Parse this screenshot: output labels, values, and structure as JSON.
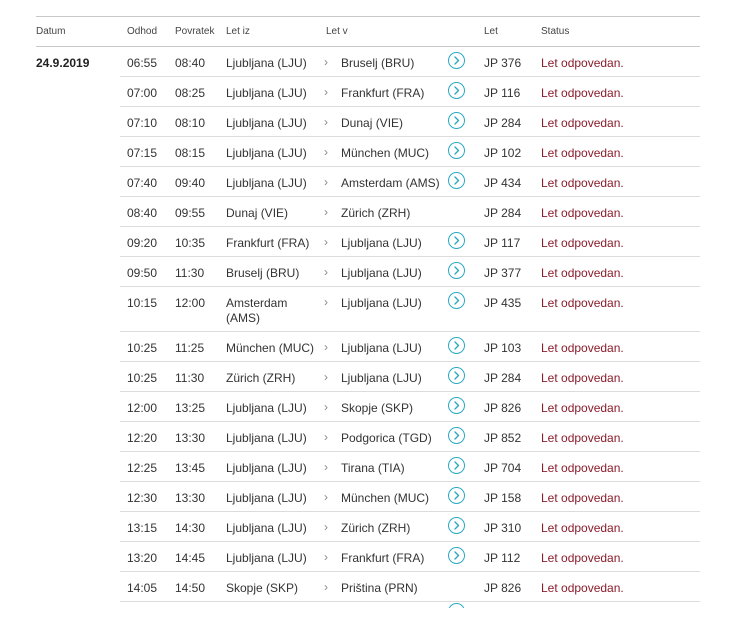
{
  "columns": {
    "date": "Datum",
    "dep": "Odhod",
    "ret": "Povratek",
    "from": "Let iz",
    "to": "Let v",
    "flight": "Let",
    "status": "Status"
  },
  "date_value": "24.9.2019",
  "rows": [
    {
      "dep": "06:55",
      "ret": "08:40",
      "from": "Ljubljana (LJU)",
      "to": "Bruselj (BRU)",
      "flight": "JP 376",
      "status": "Let odpovedan.",
      "arrow": true
    },
    {
      "dep": "07:00",
      "ret": "08:25",
      "from": "Ljubljana (LJU)",
      "to": "Frankfurt (FRA)",
      "flight": "JP 116",
      "status": "Let odpovedan.",
      "arrow": true
    },
    {
      "dep": "07:10",
      "ret": "08:10",
      "from": "Ljubljana (LJU)",
      "to": "Dunaj (VIE)",
      "flight": "JP 284",
      "status": "Let odpovedan.",
      "arrow": true
    },
    {
      "dep": "07:15",
      "ret": "08:15",
      "from": "Ljubljana (LJU)",
      "to": "München (MUC)",
      "flight": "JP 102",
      "status": "Let odpovedan.",
      "arrow": true
    },
    {
      "dep": "07:40",
      "ret": "09:40",
      "from": "Ljubljana (LJU)",
      "to": "Amsterdam (AMS)",
      "flight": "JP 434",
      "status": "Let odpovedan.",
      "arrow": true
    },
    {
      "dep": "08:40",
      "ret": "09:55",
      "from": "Dunaj (VIE)",
      "to": "Zürich (ZRH)",
      "flight": "JP 284",
      "status": "Let odpovedan.",
      "arrow": false
    },
    {
      "dep": "09:20",
      "ret": "10:35",
      "from": "Frankfurt (FRA)",
      "to": "Ljubljana (LJU)",
      "flight": "JP 117",
      "status": "Let odpovedan.",
      "arrow": true
    },
    {
      "dep": "09:50",
      "ret": "11:30",
      "from": "Bruselj (BRU)",
      "to": "Ljubljana (LJU)",
      "flight": "JP 377",
      "status": "Let odpovedan.",
      "arrow": true
    },
    {
      "dep": "10:15",
      "ret": "12:00",
      "from": "Amsterdam (AMS)",
      "to": "Ljubljana (LJU)",
      "flight": "JP 435",
      "status": "Let odpovedan.",
      "arrow": true,
      "tall": true
    },
    {
      "dep": "10:25",
      "ret": "11:25",
      "from": "München (MUC)",
      "to": "Ljubljana (LJU)",
      "flight": "JP 103",
      "status": "Let odpovedan.",
      "arrow": true
    },
    {
      "dep": "10:25",
      "ret": "11:30",
      "from": "Zürich (ZRH)",
      "to": "Ljubljana (LJU)",
      "flight": "JP 284",
      "status": "Let odpovedan.",
      "arrow": true
    },
    {
      "dep": "12:00",
      "ret": "13:25",
      "from": "Ljubljana (LJU)",
      "to": "Skopje (SKP)",
      "flight": "JP 826",
      "status": "Let odpovedan.",
      "arrow": true
    },
    {
      "dep": "12:20",
      "ret": "13:30",
      "from": "Ljubljana (LJU)",
      "to": "Podgorica (TGD)",
      "flight": "JP 852",
      "status": "Let odpovedan.",
      "arrow": true
    },
    {
      "dep": "12:25",
      "ret": "13:45",
      "from": "Ljubljana (LJU)",
      "to": "Tirana (TIA)",
      "flight": "JP 704",
      "status": "Let odpovedan.",
      "arrow": true
    },
    {
      "dep": "12:30",
      "ret": "13:30",
      "from": "Ljubljana (LJU)",
      "to": "München (MUC)",
      "flight": "JP 158",
      "status": "Let odpovedan.",
      "arrow": true
    },
    {
      "dep": "13:15",
      "ret": "14:30",
      "from": "Ljubljana (LJU)",
      "to": "Zürich (ZRH)",
      "flight": "JP 310",
      "status": "Let odpovedan.",
      "arrow": true
    },
    {
      "dep": "13:20",
      "ret": "14:45",
      "from": "Ljubljana (LJU)",
      "to": "Frankfurt (FRA)",
      "flight": "JP 112",
      "status": "Let odpovedan.",
      "arrow": true
    },
    {
      "dep": "14:05",
      "ret": "14:50",
      "from": "Skopje (SKP)",
      "to": "Priština (PRN)",
      "flight": "JP 826",
      "status": "Let odpovedan.",
      "arrow": false
    }
  ],
  "icons": {
    "row_chevron": "chevron-right-icon",
    "detail_button": "chevron-circle-right-icon"
  },
  "colors": {
    "accent": "#2aa9c2",
    "status": "#8a1c2b"
  }
}
